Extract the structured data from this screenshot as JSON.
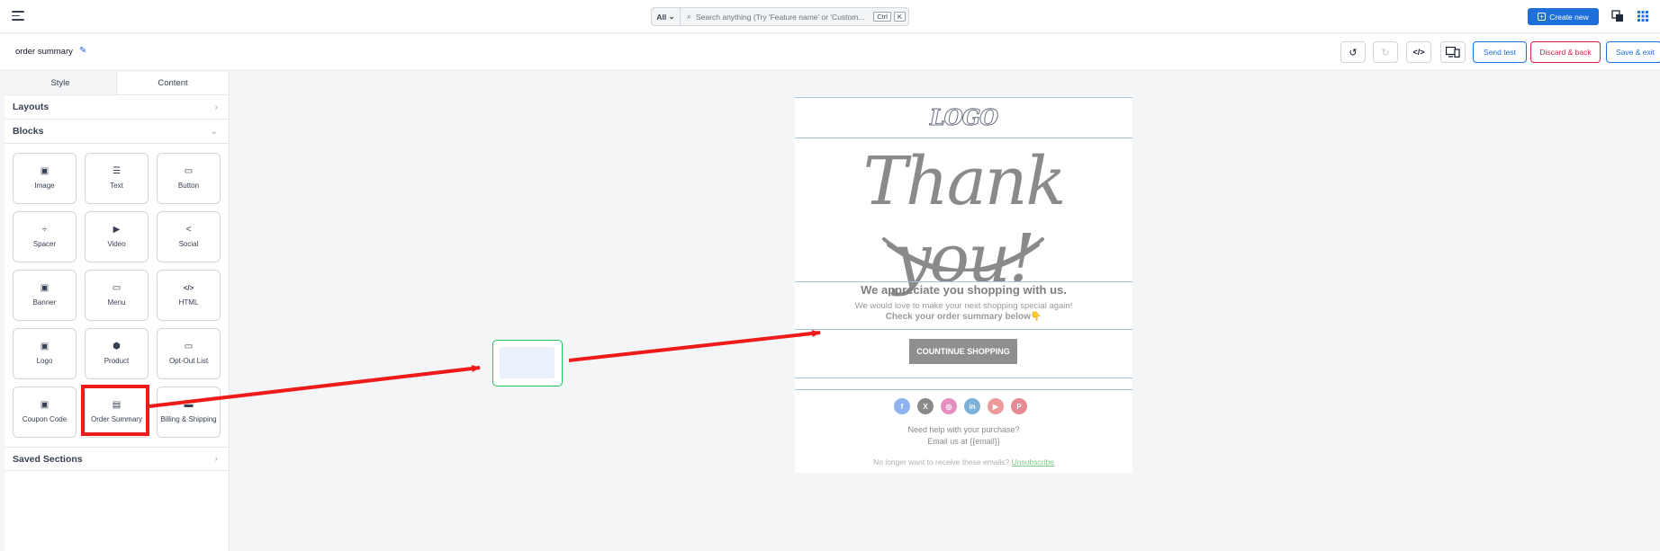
{
  "topbar": {
    "search_scope": "All",
    "search_placeholder": "Search anything (Try 'Feature name' or 'Custom...",
    "kbd_ctrl": "Ctrl",
    "kbd_k": "K",
    "create_label": "Create new"
  },
  "subbar": {
    "title": "order summary",
    "send_test": "Send test",
    "discard": "Discard & back",
    "save_exit": "Save & exit"
  },
  "sidebar": {
    "tabs": [
      "Style",
      "Content"
    ],
    "layouts": "Layouts",
    "blocks": "Blocks",
    "saved_sections": "Saved Sections",
    "block_items": [
      {
        "label": "Image",
        "icon": "image-icon"
      },
      {
        "label": "Text",
        "icon": "text-icon"
      },
      {
        "label": "Button",
        "icon": "button-icon"
      },
      {
        "label": "Spacer",
        "icon": "spacer-icon"
      },
      {
        "label": "Video",
        "icon": "video-icon"
      },
      {
        "label": "Social",
        "icon": "share-icon"
      },
      {
        "label": "Banner",
        "icon": "banner-icon"
      },
      {
        "label": "Menu",
        "icon": "menu-icon"
      },
      {
        "label": "HTML",
        "icon": "code-icon"
      },
      {
        "label": "Logo",
        "icon": "logo-icon"
      },
      {
        "label": "Product",
        "icon": "box-icon"
      },
      {
        "label": "Opt-Out List",
        "icon": "list-icon"
      },
      {
        "label": "Coupon Code",
        "icon": "coupon-icon"
      },
      {
        "label": "Order Summary",
        "icon": "receipt-icon"
      },
      {
        "label": "Billing & Shipping",
        "icon": "card-icon"
      }
    ]
  },
  "email": {
    "logo": "LOGO",
    "thank_you": "Thank you!",
    "appreciate": "We appreciate you shopping with us.",
    "love": "We would love to make your next shopping special again!",
    "check": "Check your order summary below👇",
    "shop_button": "COUNTINUE SHOPPING",
    "socials": [
      {
        "name": "facebook",
        "glyph": "f",
        "color": "#8fb3ee"
      },
      {
        "name": "x",
        "glyph": "X",
        "color": "#8a8a8a"
      },
      {
        "name": "instagram",
        "glyph": "◎",
        "color": "#e58fc0"
      },
      {
        "name": "linkedin",
        "glyph": "in",
        "color": "#7fb0d8"
      },
      {
        "name": "youtube",
        "glyph": "▶",
        "color": "#ee9a9a"
      },
      {
        "name": "pinterest",
        "glyph": "P",
        "color": "#e58a94"
      }
    ],
    "help1": "Need help with your purchase?",
    "help2": "Email us at {{email}}",
    "nolonger": "No longer want to receive these emails?",
    "unsubscribe": "Unsubscribe"
  },
  "colors": {
    "accent": "#1d6fdc",
    "danger": "#e11d48",
    "annotation": "#ef1b1b",
    "drop_target": "#22c55e"
  }
}
